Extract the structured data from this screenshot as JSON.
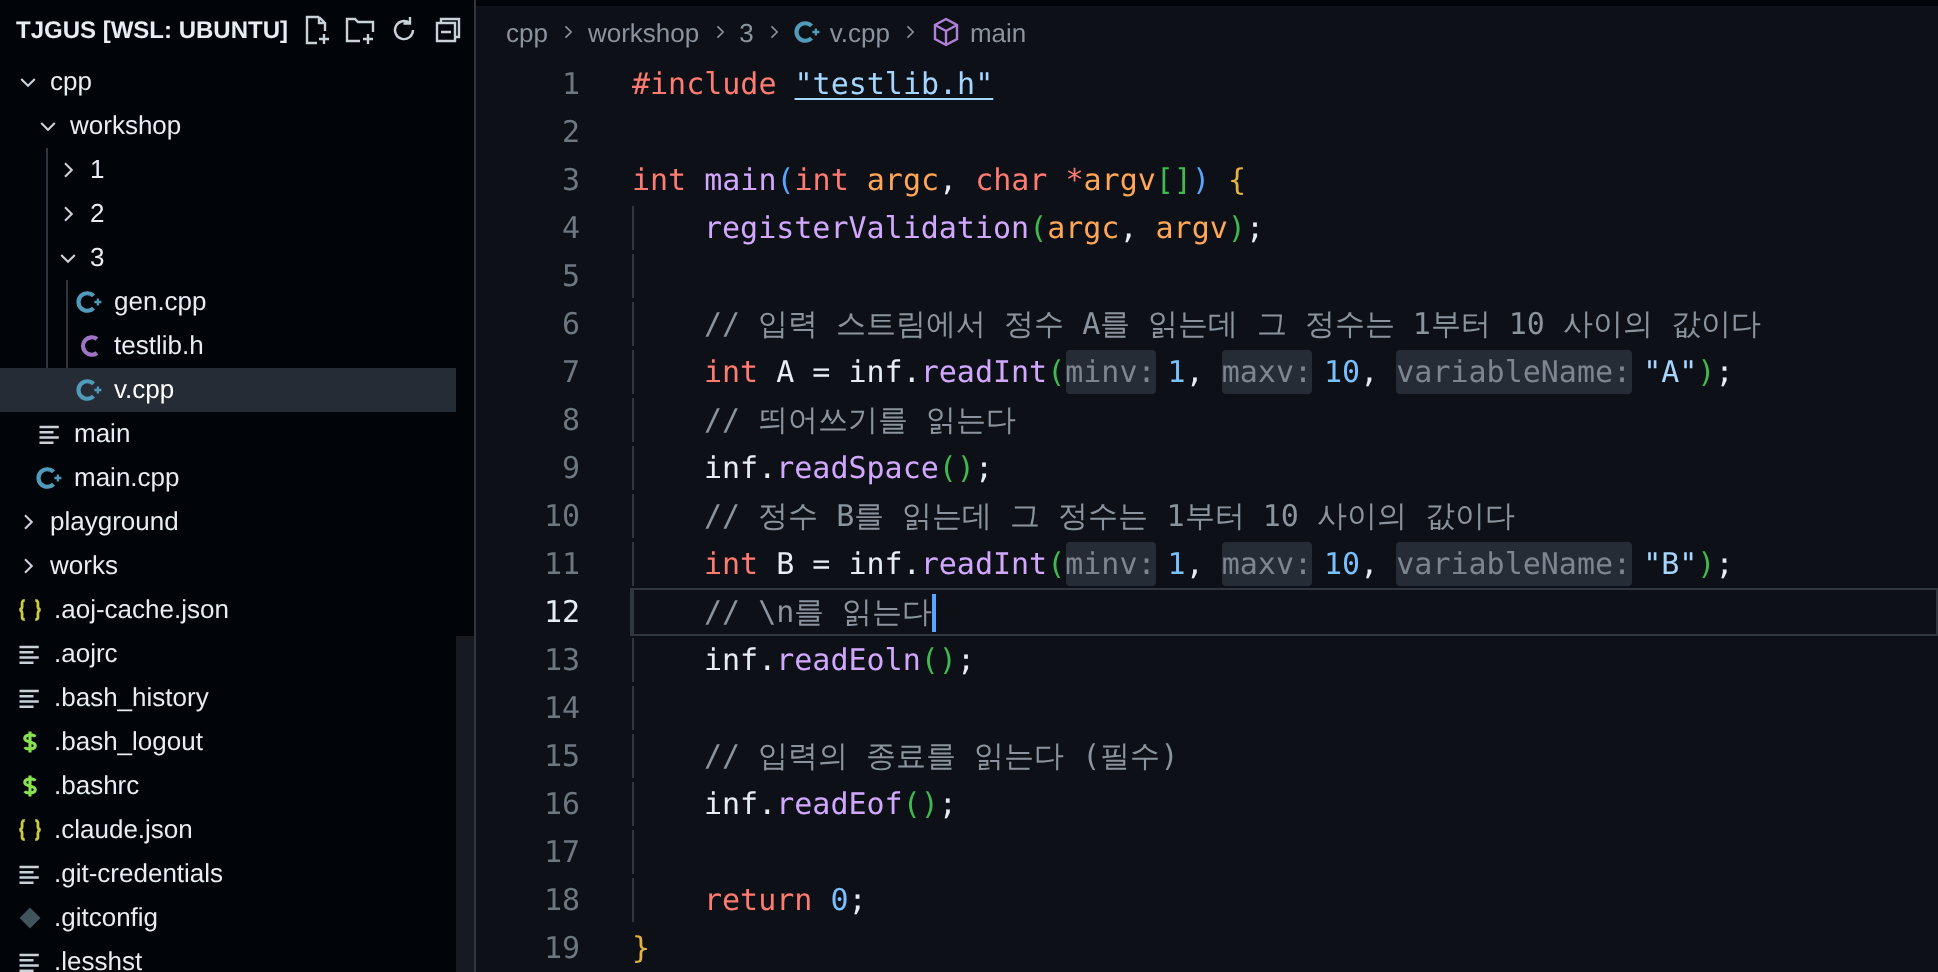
{
  "explorer": {
    "title": "TJGUS [WSL: UBUNTU]",
    "tree": [
      {
        "name": "cpp",
        "kind": "folder",
        "expanded": true,
        "selected": false,
        "children": [
          {
            "name": "workshop",
            "kind": "folder",
            "expanded": true,
            "selected": false,
            "children": [
              {
                "name": "1",
                "kind": "folder",
                "expanded": false,
                "selected": false
              },
              {
                "name": "2",
                "kind": "folder",
                "expanded": false,
                "selected": false
              },
              {
                "name": "3",
                "kind": "folder",
                "expanded": true,
                "selected": false,
                "children": [
                  {
                    "name": "gen.cpp",
                    "kind": "cpp",
                    "selected": false
                  },
                  {
                    "name": "testlib.h",
                    "kind": "header",
                    "selected": false
                  },
                  {
                    "name": "v.cpp",
                    "kind": "cpp",
                    "selected": true
                  }
                ]
              }
            ]
          },
          {
            "name": "main",
            "kind": "text",
            "selected": false
          },
          {
            "name": "main.cpp",
            "kind": "cpp",
            "selected": false
          }
        ]
      },
      {
        "name": "playground",
        "kind": "folder",
        "expanded": false,
        "selected": false
      },
      {
        "name": "works",
        "kind": "folder",
        "expanded": false,
        "selected": false
      },
      {
        "name": ".aoj-cache.json",
        "kind": "json",
        "selected": false
      },
      {
        "name": ".aojrc",
        "kind": "text",
        "selected": false
      },
      {
        "name": ".bash_history",
        "kind": "text",
        "selected": false
      },
      {
        "name": ".bash_logout",
        "kind": "shell",
        "selected": false
      },
      {
        "name": ".bashrc",
        "kind": "shell",
        "selected": false
      },
      {
        "name": ".claude.json",
        "kind": "json",
        "selected": false
      },
      {
        "name": ".git-credentials",
        "kind": "text",
        "selected": false
      },
      {
        "name": ".gitconfig",
        "kind": "git",
        "selected": false
      },
      {
        "name": ".lesshst",
        "kind": "text",
        "selected": false
      }
    ]
  },
  "breadcrumbs": [
    {
      "text": "cpp",
      "kind": "folder"
    },
    {
      "text": "workshop",
      "kind": "folder"
    },
    {
      "text": "3",
      "kind": "folder"
    },
    {
      "text": "v.cpp",
      "kind": "cpp"
    },
    {
      "text": "main",
      "kind": "symbol"
    }
  ],
  "editor": {
    "lines": [
      {
        "number": "1",
        "indented": false,
        "current": false,
        "tokens": [
          {
            "kind": "keyword",
            "text": "#include "
          },
          {
            "kind": "link",
            "text": "\"testlib.h\""
          }
        ]
      },
      {
        "number": "2",
        "current": false
      },
      {
        "number": "3",
        "indented": false,
        "current": false,
        "tokens": [
          {
            "kind": "keyword",
            "text": "int "
          },
          {
            "kind": "func",
            "text": "main"
          },
          {
            "kind": "bracket1",
            "text": "("
          },
          {
            "kind": "keyword",
            "text": "int "
          },
          {
            "kind": "param",
            "text": "argc"
          },
          {
            "kind": "plain",
            "text": ", "
          },
          {
            "kind": "keyword",
            "text": "char *"
          },
          {
            "kind": "param",
            "text": "argv"
          },
          {
            "kind": "bracket2",
            "text": "[]"
          },
          {
            "kind": "bracket1",
            "text": ")"
          },
          {
            "kind": "bracket3",
            "text": " {"
          }
        ]
      },
      {
        "number": "4",
        "indented": true,
        "current": false,
        "tokens": [
          {
            "kind": "func",
            "text": "registerValidation"
          },
          {
            "kind": "bracket2",
            "text": "("
          },
          {
            "kind": "param",
            "text": "argc"
          },
          {
            "kind": "plain",
            "text": ", "
          },
          {
            "kind": "param",
            "text": "argv"
          },
          {
            "kind": "bracket2",
            "text": ")"
          },
          {
            "kind": "plain",
            "text": ";"
          }
        ]
      },
      {
        "number": "5",
        "current": false
      },
      {
        "number": "6",
        "indented": true,
        "current": false,
        "tokens": [
          {
            "kind": "comment",
            "text": "// 입력 스트림에서 정수 A를 읽는데 그 정수는 1부터 10 사이의 값이다"
          }
        ]
      },
      {
        "number": "7",
        "indented": true,
        "current": false,
        "tokens": [
          {
            "kind": "keyword",
            "text": "int "
          },
          {
            "kind": "plain",
            "text": "A = inf."
          },
          {
            "kind": "func",
            "text": "readInt"
          },
          {
            "kind": "bracket2",
            "text": "("
          },
          {
            "kind": "hint",
            "text": "minv:"
          },
          {
            "kind": "number",
            "text": "1"
          },
          {
            "kind": "plain",
            "text": ", "
          },
          {
            "kind": "hint",
            "text": "maxv:"
          },
          {
            "kind": "number",
            "text": "10"
          },
          {
            "kind": "plain",
            "text": ", "
          },
          {
            "kind": "hint",
            "text": "variableName:"
          },
          {
            "kind": "string",
            "text": "\"A\""
          },
          {
            "kind": "bracket2",
            "text": ")"
          },
          {
            "kind": "plain",
            "text": ";"
          }
        ]
      },
      {
        "number": "8",
        "indented": true,
        "current": false,
        "tokens": [
          {
            "kind": "comment",
            "text": "// 띄어쓰기를 읽는다"
          }
        ]
      },
      {
        "number": "9",
        "indented": true,
        "current": false,
        "tokens": [
          {
            "kind": "plain",
            "text": "inf."
          },
          {
            "kind": "func",
            "text": "readSpace"
          },
          {
            "kind": "bracket2",
            "text": "()"
          },
          {
            "kind": "plain",
            "text": ";"
          }
        ]
      },
      {
        "number": "10",
        "indented": true,
        "current": false,
        "tokens": [
          {
            "kind": "comment",
            "text": "// 정수 B를 읽는데 그 정수는 1부터 10 사이의 값이다"
          }
        ]
      },
      {
        "number": "11",
        "indented": true,
        "current": false,
        "tokens": [
          {
            "kind": "keyword",
            "text": "int "
          },
          {
            "kind": "plain",
            "text": "B = inf."
          },
          {
            "kind": "func",
            "text": "readInt"
          },
          {
            "kind": "bracket2",
            "text": "("
          },
          {
            "kind": "hint",
            "text": "minv:"
          },
          {
            "kind": "number",
            "text": "1"
          },
          {
            "kind": "plain",
            "text": ", "
          },
          {
            "kind": "hint",
            "text": "maxv:"
          },
          {
            "kind": "number",
            "text": "10"
          },
          {
            "kind": "plain",
            "text": ", "
          },
          {
            "kind": "hint",
            "text": "variableName:"
          },
          {
            "kind": "string",
            "text": "\"B\""
          },
          {
            "kind": "bracket2",
            "text": ")"
          },
          {
            "kind": "plain",
            "text": ";"
          }
        ]
      },
      {
        "number": "12",
        "indented": true,
        "current": true,
        "tokens": [
          {
            "kind": "comment",
            "text": "// \\n를 읽는다"
          }
        ]
      },
      {
        "number": "13",
        "indented": true,
        "current": false,
        "tokens": [
          {
            "kind": "plain",
            "text": "inf."
          },
          {
            "kind": "func",
            "text": "readEoln"
          },
          {
            "kind": "bracket2",
            "text": "()"
          },
          {
            "kind": "plain",
            "text": ";"
          }
        ]
      },
      {
        "number": "14",
        "current": false
      },
      {
        "number": "15",
        "indented": true,
        "current": false,
        "tokens": [
          {
            "kind": "comment",
            "text": "// 입력의 종료를 읽는다 (필수)"
          }
        ]
      },
      {
        "number": "16",
        "indented": true,
        "current": false,
        "tokens": [
          {
            "kind": "plain",
            "text": "inf."
          },
          {
            "kind": "func",
            "text": "readEof"
          },
          {
            "kind": "bracket2",
            "text": "()"
          },
          {
            "kind": "plain",
            "text": ";"
          }
        ]
      },
      {
        "number": "17",
        "current": false
      },
      {
        "number": "18",
        "indented": true,
        "current": false,
        "tokens": [
          {
            "kind": "keyword",
            "text": "return "
          },
          {
            "kind": "number",
            "text": "0"
          },
          {
            "kind": "plain",
            "text": ";"
          }
        ]
      },
      {
        "number": "19",
        "indented": false,
        "current": false,
        "tokens": [
          {
            "kind": "bracket3",
            "text": "}"
          }
        ]
      }
    ]
  }
}
